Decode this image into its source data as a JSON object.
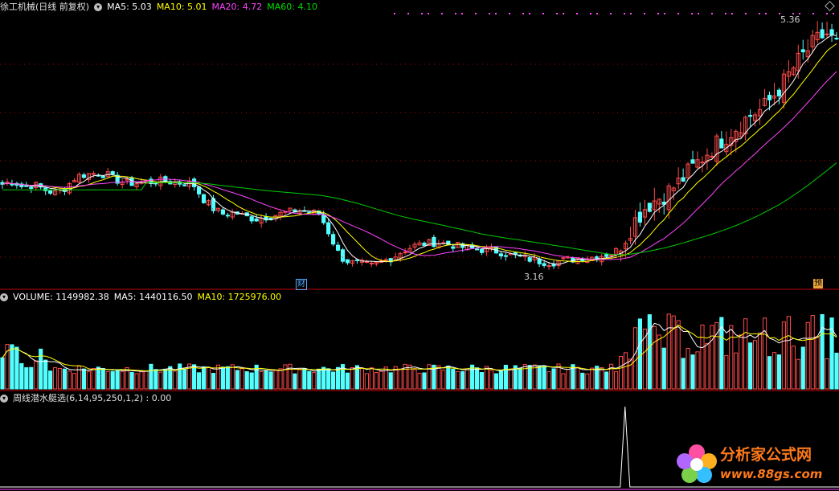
{
  "colors": {
    "up": "#ff4a4a",
    "down": "#54ffff",
    "ma5": "#ffffff",
    "ma10": "#ffff00",
    "ma20": "#ff44ff",
    "ma60": "#00cc00",
    "divider": "#c00000",
    "indicator": "#ffffff"
  },
  "price_header": {
    "title": "徐工机械(日线 前复权)",
    "ma5": "MA5: 5.03",
    "ma10": "MA10: 5.01",
    "ma20": "MA20: 4.72",
    "ma60": "MA60: 4.10"
  },
  "volume_header": {
    "volume": "VOLUME: 1149982.38",
    "ma5": "MA5: 1440116.50",
    "ma10": "MA10: 1725976.00"
  },
  "indicator_header": {
    "formula": "周线潜水艇选(6,14,95,250,1,2) : 0.00"
  },
  "annotations": {
    "high": "5.36",
    "low": "3.16",
    "badge_cai": "财",
    "badge_yu": "预"
  },
  "watermark": {
    "title": "分析家公式网",
    "url": "www.88gs.com"
  },
  "chart_data": [
    {
      "type": "candlestick",
      "panel": "price",
      "series": [
        {
          "name": "MA5",
          "last": 5.03
        },
        {
          "name": "MA10",
          "last": 5.01
        },
        {
          "name": "MA20",
          "last": 4.72
        },
        {
          "name": "MA60",
          "last": 4.1
        }
      ],
      "annotated_high": 5.36,
      "annotated_low": 3.16,
      "approx_close_path": [
        3.95,
        3.98,
        3.92,
        3.95,
        3.9,
        3.87,
        3.92,
        4.02,
        4.04,
        4.05,
        4.03,
        3.98,
        3.96,
        3.96,
        3.97,
        3.98,
        3.97,
        3.96,
        3.96,
        3.82,
        3.73,
        3.68,
        3.7,
        3.66,
        3.64,
        3.66,
        3.68,
        3.7,
        3.72,
        3.7,
        3.69,
        3.5,
        3.3,
        3.25,
        3.24,
        3.22,
        3.26,
        3.3,
        3.36,
        3.4,
        3.42,
        3.43,
        3.42,
        3.4,
        3.38,
        3.37,
        3.36,
        3.35,
        3.32,
        3.3,
        3.28,
        3.26,
        3.25,
        3.27,
        3.28,
        3.3,
        3.3,
        3.32,
        3.34,
        3.48,
        3.64,
        3.76,
        3.82,
        3.88,
        3.96,
        4.06,
        4.16,
        4.26,
        4.34,
        4.42,
        4.5,
        4.58,
        4.62,
        4.74,
        4.86,
        5.0,
        5.12,
        5.22,
        5.3,
        5.2
      ]
    },
    {
      "type": "bar",
      "panel": "volume",
      "series": [
        {
          "name": "VOLUME",
          "last": 1149982.38
        },
        {
          "name": "MA5",
          "last": 1440116.5
        },
        {
          "name": "MA10",
          "last": 1725976.0
        }
      ]
    },
    {
      "type": "line",
      "panel": "indicator",
      "series": [
        {
          "name": "周线潜水艇选",
          "last": 0.0
        }
      ],
      "spike_position": 0.745
    }
  ]
}
